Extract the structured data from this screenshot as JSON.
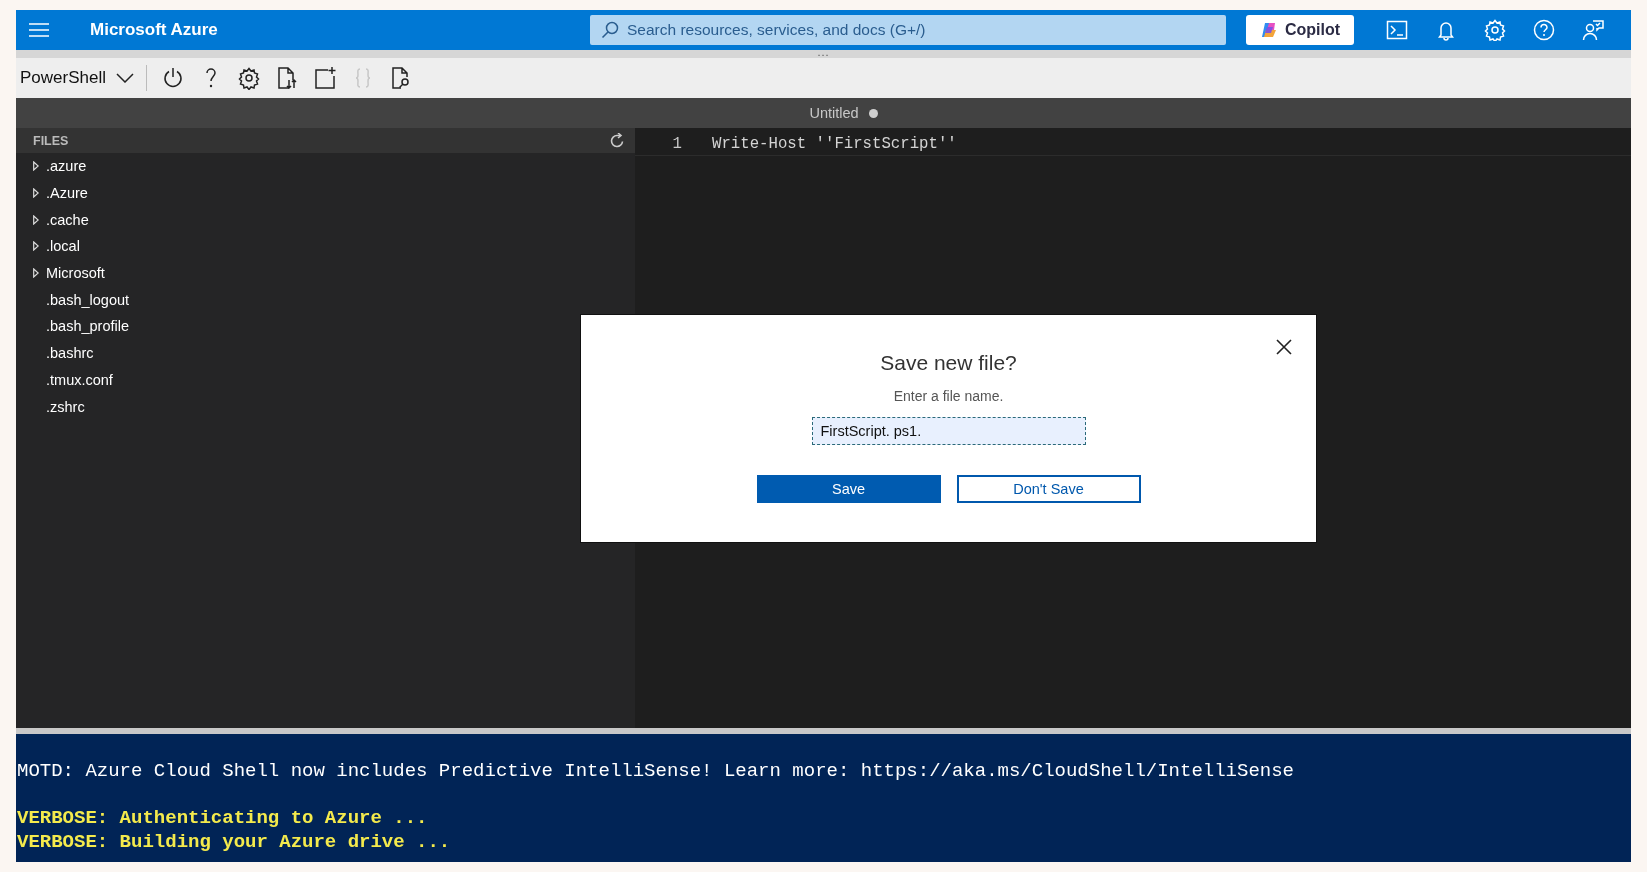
{
  "topbar": {
    "brand": "Microsoft Azure",
    "search": {
      "placeholder": "Search resources, services, and docs (G+/)"
    },
    "copilot": "Copilot"
  },
  "splitter": "...",
  "toolbar": {
    "shell": "PowerShell",
    "tools": [
      {
        "kind": "power",
        "disabled": false
      },
      {
        "kind": "help",
        "disabled": false
      },
      {
        "kind": "settings",
        "disabled": false
      },
      {
        "kind": "transfer",
        "disabled": false
      },
      {
        "kind": "newfile",
        "disabled": false
      },
      {
        "kind": "braces",
        "disabled": true
      },
      {
        "kind": "preview",
        "disabled": false
      }
    ]
  },
  "editor_tab": {
    "title": "Untitled",
    "unsaved": true
  },
  "files": {
    "header": "FILES",
    "items": [
      {
        "name": ".azure",
        "kind": "folder",
        "expanded": false
      },
      {
        "name": ".Azure",
        "kind": "folder",
        "expanded": false
      },
      {
        "name": ".cache",
        "kind": "folder",
        "expanded": false
      },
      {
        "name": ".local",
        "kind": "folder",
        "expanded": false
      },
      {
        "name": "Microsoft",
        "kind": "folder",
        "expanded": false
      },
      {
        "name": ".bash_logout",
        "kind": "file"
      },
      {
        "name": ".bash_profile",
        "kind": "file"
      },
      {
        "name": ".bashrc",
        "kind": "file"
      },
      {
        "name": ".tmux.conf",
        "kind": "file"
      },
      {
        "name": ".zshrc",
        "kind": "file"
      }
    ]
  },
  "editor": {
    "lines": [
      {
        "number": "1",
        "code": "Write-Host ''FirstScript''"
      }
    ]
  },
  "dialog": {
    "title": "Save new file?",
    "prompt": "Enter a file name.",
    "value": "FirstScript. ps1.",
    "buttons": [
      {
        "label": "Save",
        "kind": "primary"
      },
      {
        "label": "Don't Save",
        "kind": "secondary"
      }
    ]
  },
  "terminal": {
    "lines": [
      {
        "text": "MOTD: Azure Cloud Shell now includes Predictive IntelliSense! Learn more: https://aka.ms/CloudShell/IntelliSense",
        "kind": "info"
      },
      {
        "kind": "blank"
      },
      {
        "text": "VERBOSE: Authenticating to Azure ...",
        "kind": "verbose"
      },
      {
        "text": "VERBOSE: Building your Azure drive ...",
        "kind": "verbose"
      }
    ]
  }
}
